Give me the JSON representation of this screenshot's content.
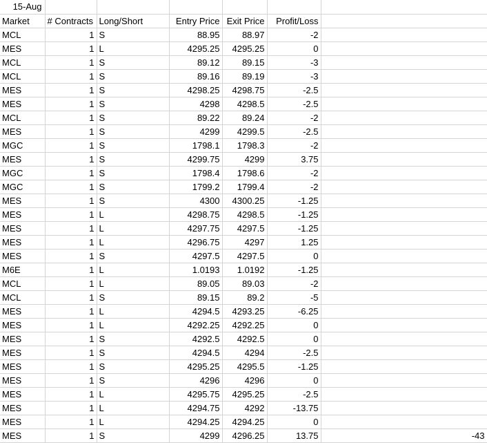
{
  "date": "15-Aug",
  "headers": [
    "Market",
    "# Contracts",
    "Long/Short",
    "Entry Price",
    "Exit Price",
    "Profit/Loss",
    ""
  ],
  "rows": [
    [
      "MCL",
      "1",
      "S",
      "88.95",
      "88.97",
      "-2",
      ""
    ],
    [
      "MES",
      "1",
      "L",
      "4295.25",
      "4295.25",
      "0",
      ""
    ],
    [
      "MCL",
      "1",
      "S",
      "89.12",
      "89.15",
      "-3",
      ""
    ],
    [
      "MCL",
      "1",
      "S",
      "89.16",
      "89.19",
      "-3",
      ""
    ],
    [
      "MES",
      "1",
      "S",
      "4298.25",
      "4298.75",
      "-2.5",
      ""
    ],
    [
      "MES",
      "1",
      "S",
      "4298",
      "4298.5",
      "-2.5",
      ""
    ],
    [
      "MCL",
      "1",
      "S",
      "89.22",
      "89.24",
      "-2",
      ""
    ],
    [
      "MES",
      "1",
      "S",
      "4299",
      "4299.5",
      "-2.5",
      ""
    ],
    [
      "MGC",
      "1",
      "S",
      "1798.1",
      "1798.3",
      "-2",
      ""
    ],
    [
      "MES",
      "1",
      "S",
      "4299.75",
      "4299",
      "3.75",
      ""
    ],
    [
      "MGC",
      "1",
      "S",
      "1798.4",
      "1798.6",
      "-2",
      ""
    ],
    [
      "MGC",
      "1",
      "S",
      "1799.2",
      "1799.4",
      "-2",
      ""
    ],
    [
      "MES",
      "1",
      "S",
      "4300",
      "4300.25",
      "-1.25",
      ""
    ],
    [
      "MES",
      "1",
      "L",
      "4298.75",
      "4298.5",
      "-1.25",
      ""
    ],
    [
      "MES",
      "1",
      "L",
      "4297.75",
      "4297.5",
      "-1.25",
      ""
    ],
    [
      "MES",
      "1",
      "L",
      "4296.75",
      "4297",
      "1.25",
      ""
    ],
    [
      "MES",
      "1",
      "S",
      "4297.5",
      "4297.5",
      "0",
      ""
    ],
    [
      "M6E",
      "1",
      "L",
      "1.0193",
      "1.0192",
      "-1.25",
      ""
    ],
    [
      "MCL",
      "1",
      "L",
      "89.05",
      "89.03",
      "-2",
      ""
    ],
    [
      "MCL",
      "1",
      "S",
      "89.15",
      "89.2",
      "-5",
      ""
    ],
    [
      "MES",
      "1",
      "L",
      "4294.5",
      "4293.25",
      "-6.25",
      ""
    ],
    [
      "MES",
      "1",
      "L",
      "4292.25",
      "4292.25",
      "0",
      ""
    ],
    [
      "MES",
      "1",
      "S",
      "4292.5",
      "4292.5",
      "0",
      ""
    ],
    [
      "MES",
      "1",
      "S",
      "4294.5",
      "4294",
      "-2.5",
      ""
    ],
    [
      "MES",
      "1",
      "S",
      "4295.25",
      "4295.5",
      "-1.25",
      ""
    ],
    [
      "MES",
      "1",
      "S",
      "4296",
      "4296",
      "0",
      ""
    ],
    [
      "MES",
      "1",
      "L",
      "4295.75",
      "4295.25",
      "-2.5",
      ""
    ],
    [
      "MES",
      "1",
      "L",
      "4294.75",
      "4292",
      "-13.75",
      ""
    ],
    [
      "MES",
      "1",
      "L",
      "4294.25",
      "4294.25",
      "0",
      ""
    ],
    [
      "MES",
      "1",
      "S",
      "4299",
      "4296.25",
      "13.75",
      "-43"
    ]
  ],
  "alignments": [
    "txt",
    "num",
    "txt",
    "num",
    "num",
    "num",
    "num"
  ]
}
